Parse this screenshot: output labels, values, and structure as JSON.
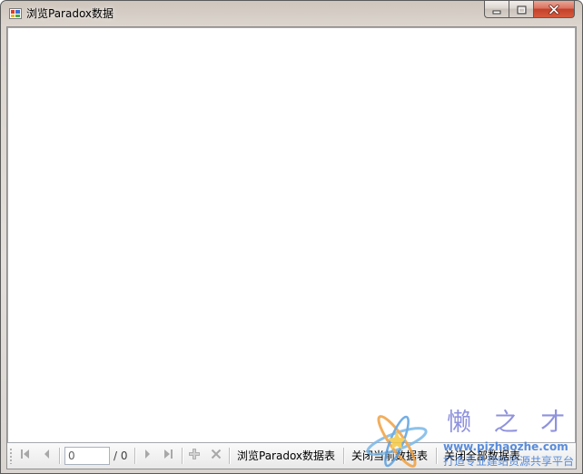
{
  "window": {
    "title": "浏览Paradox数据",
    "icon": "app-icon",
    "controls": {
      "minimize_icon": "minimize-icon",
      "maximize_icon": "maximize-icon",
      "close_icon": "close-icon"
    }
  },
  "navigator": {
    "move_first_icon": "move-first-icon",
    "move_previous_icon": "move-previous-icon",
    "position_value": "0",
    "count_label": "/ 0",
    "move_next_icon": "move-next-icon",
    "move_last_icon": "move-last-icon",
    "add_new_icon": "add-icon",
    "delete_icon": "delete-icon",
    "navigation_enabled": false,
    "actions": [
      {
        "label": "浏览Paradox数据表"
      },
      {
        "label": "关闭当前数据表"
      },
      {
        "label": "关闭全部数据表"
      }
    ]
  },
  "watermark": {
    "brand": "懒 之 才",
    "url": "www.pizhaozhe.com",
    "slogan": "打造专业建站资源共享平台"
  },
  "colors": {
    "close_button": "#c4402a",
    "content_background": "#ffffff",
    "toolbar_background": "#f0f0f0",
    "disabled_icon": "#a8a8a8",
    "watermark_text": "#3d7ad6",
    "watermark_brand": "#7c80d8"
  }
}
